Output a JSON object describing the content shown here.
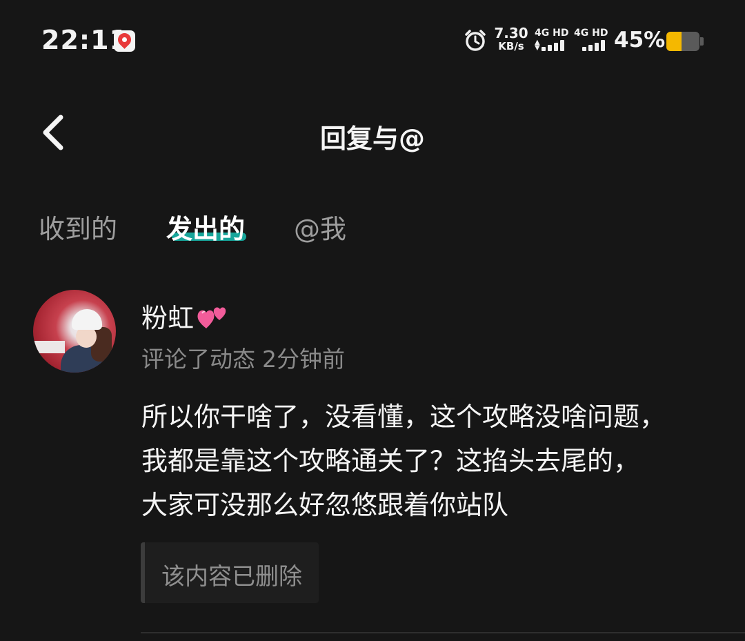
{
  "status_bar": {
    "time": "22:11",
    "net_speed_value": "7.30",
    "net_speed_unit": "KB/s",
    "sim1_label": "4G HD",
    "sim2_label": "4G HD",
    "battery_percent": "45%",
    "battery_level": 0.45,
    "battery_color": "#f5b800",
    "icons": [
      "map-app-icon",
      "alarm-icon",
      "signal-icon",
      "battery-icon"
    ]
  },
  "header": {
    "title": "回复与@",
    "back_icon": "chevron-left-icon"
  },
  "tabs": [
    {
      "label": "收到的",
      "active": false
    },
    {
      "label": "发出的",
      "active": true
    },
    {
      "label": "@我",
      "active": false
    }
  ],
  "accent_color": "#17a59a",
  "message": {
    "username": "粉虹",
    "username_badge": "hearts-icon",
    "action": "评论了动态",
    "time": "2分钟前",
    "content_lines": [
      "所以你干啥了，没看懂，这个攻略没啥问题，",
      "我都是靠这个攻略通关了？这掐头去尾的，",
      "大家可没那么好忽悠跟着你站队"
    ],
    "quoted_text": "该内容已删除"
  }
}
